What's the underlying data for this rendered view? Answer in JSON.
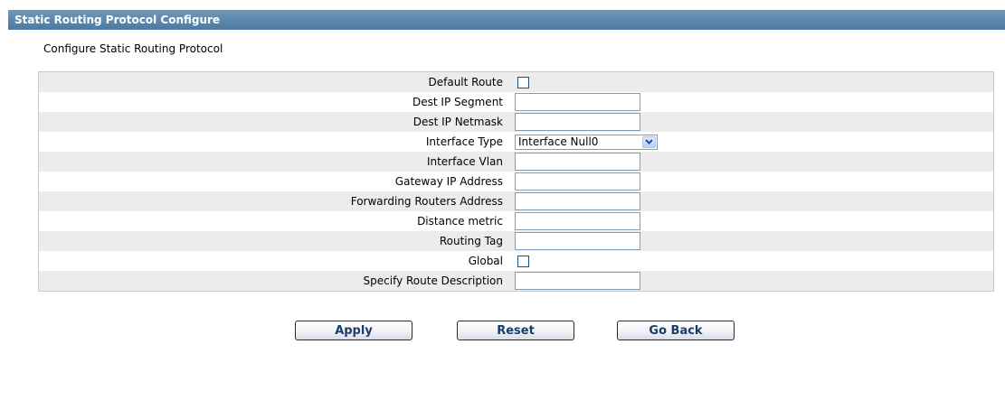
{
  "header": {
    "title": "Static Routing Protocol Configure"
  },
  "section": {
    "subtitle": "Configure Static Routing Protocol"
  },
  "form": {
    "rows": [
      {
        "label": "Default Route",
        "control": "checkbox",
        "checked": false
      },
      {
        "label": "Dest IP Segment",
        "control": "text",
        "value": ""
      },
      {
        "label": "Dest IP Netmask",
        "control": "text",
        "value": ""
      },
      {
        "label": "Interface Type",
        "control": "select",
        "value": "Interface Null0"
      },
      {
        "label": "Interface Vlan",
        "control": "text",
        "value": ""
      },
      {
        "label": "Gateway IP Address",
        "control": "text",
        "value": ""
      },
      {
        "label": "Forwarding Routers Address",
        "control": "text",
        "value": ""
      },
      {
        "label": "Distance metric",
        "control": "text",
        "value": ""
      },
      {
        "label": "Routing Tag",
        "control": "text",
        "value": ""
      },
      {
        "label": "Global",
        "control": "checkbox",
        "checked": false
      },
      {
        "label": "Specify Route Description",
        "control": "text",
        "value": ""
      }
    ]
  },
  "buttons": {
    "apply": "Apply",
    "reset": "Reset",
    "go_back": "Go Back"
  },
  "colors": {
    "title_bar": "#5a84a8",
    "row_alt": "#ececec",
    "button_text": "#1a3c6a"
  }
}
